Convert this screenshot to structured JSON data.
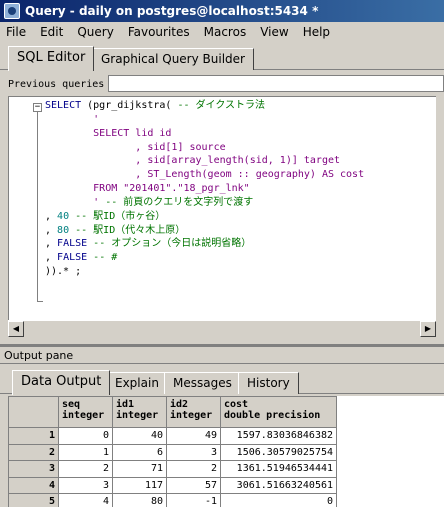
{
  "window": {
    "title": "Query - daily on postgres@localhost:5434 *"
  },
  "menu": [
    "File",
    "Edit",
    "Query",
    "Favourites",
    "Macros",
    "View",
    "Help"
  ],
  "editor_tabs": [
    "SQL Editor",
    "Graphical Query Builder"
  ],
  "previous_queries_label": "Previous queries",
  "sql_lines": [
    "SELECT (pgr_dijkstra( -- ダイクストラ法",
    "        '",
    "        SELECT lid id",
    "               , sid[1] source",
    "               , sid[array_length(sid, 1)] target",
    "               , ST_Length(geom :: geography) AS cost",
    "",
    "        FROM \"201401\".\"18_pgr_lnk\"",
    "        ' -- 前頁のクエリを文字列で渡す",
    "",
    ", 40 -- 駅ID（市ヶ谷）",
    ", 80 -- 駅ID（代々木上原）",
    ", FALSE -- オプション（今日は説明省略）",
    ", FALSE -- #",
    ")).* ;"
  ],
  "output_pane_label": "Output pane",
  "output_tabs": [
    "Data Output",
    "Explain",
    "Messages",
    "History"
  ],
  "grid": {
    "columns": [
      {
        "name": "seq",
        "type": "integer"
      },
      {
        "name": "id1",
        "type": "integer"
      },
      {
        "name": "id2",
        "type": "integer"
      },
      {
        "name": "cost",
        "type": "double precision"
      }
    ],
    "rows": [
      {
        "n": "1",
        "seq": "0",
        "id1": "40",
        "id2": "49",
        "cost": "1597.83036846382"
      },
      {
        "n": "2",
        "seq": "1",
        "id1": "6",
        "id2": "3",
        "cost": "1506.30579025754"
      },
      {
        "n": "3",
        "seq": "2",
        "id1": "71",
        "id2": "2",
        "cost": "1361.51946534441"
      },
      {
        "n": "4",
        "seq": "3",
        "id1": "117",
        "id2": "57",
        "cost": "3061.51663240561"
      },
      {
        "n": "5",
        "seq": "4",
        "id1": "80",
        "id2": "-1",
        "cost": "0"
      }
    ]
  }
}
